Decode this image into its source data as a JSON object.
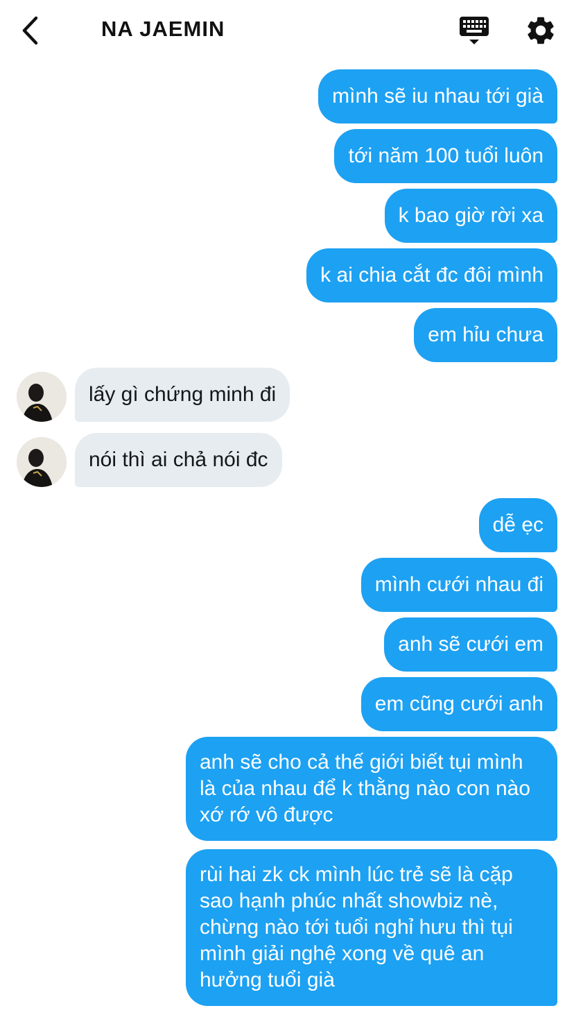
{
  "header": {
    "title": "NA JAEMIN",
    "back_icon": "chevron-left-icon",
    "keyboard_icon": "keyboard-icon",
    "settings_icon": "gear-icon"
  },
  "colors": {
    "outgoing_bubble": "#1da1f2",
    "incoming_bubble": "#e6ecf0"
  },
  "messages": [
    {
      "dir": "out",
      "text": "mình sẽ iu nhau tới già"
    },
    {
      "dir": "out",
      "text": "tới năm 100 tuổi luôn"
    },
    {
      "dir": "out",
      "text": "k bao giờ rời xa"
    },
    {
      "dir": "out",
      "text": "k ai chia cắt đc đôi mình"
    },
    {
      "dir": "out",
      "text": "em hỉu chưa"
    },
    {
      "dir": "in",
      "text": "lấy gì chứng minh đi"
    },
    {
      "dir": "in",
      "text": "nói thì ai chả nói đc"
    },
    {
      "dir": "out",
      "text": "dễ ẹc"
    },
    {
      "dir": "out",
      "text": "mình cưới nhau đi"
    },
    {
      "dir": "out",
      "text": "anh sẽ cưới em"
    },
    {
      "dir": "out",
      "text": "em cũng cưới anh"
    },
    {
      "dir": "out",
      "text": "anh sẽ cho cả thế giới biết tụi mình là của nhau để k thằng nào con nào xớ rớ vô được"
    },
    {
      "dir": "out",
      "text": "rùi hai zk ck mình lúc trẻ sẽ là cặp sao hạnh phúc nhất showbiz nè, chừng nào tới tuổi nghỉ hưu thì tụi mình giải nghệ xong về quê an hưởng tuổi già"
    }
  ]
}
